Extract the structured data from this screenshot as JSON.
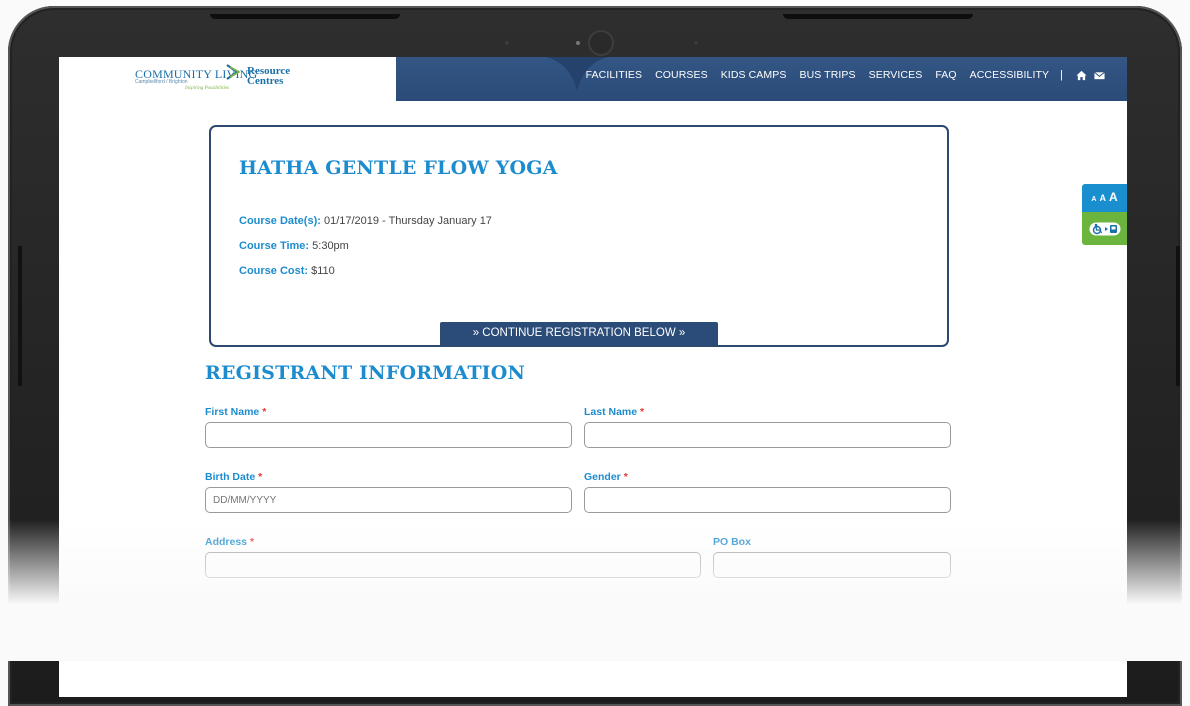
{
  "brand": {
    "name_main": "COMMUNITY LIVING",
    "name_sub": "Campbellford / Brighton",
    "tagline": "Inspiring Possibilities",
    "resource_line1": "Resource",
    "resource_line2": "Centres"
  },
  "nav": {
    "items": [
      "FACILITIES",
      "COURSES",
      "KIDS CAMPS",
      "BUS TRIPS",
      "SERVICES",
      "FAQ",
      "ACCESSIBILITY"
    ],
    "separator": "|",
    "icons": [
      "home-icon",
      "envelope-icon"
    ]
  },
  "accessibility_widget": {
    "size_labels": [
      "A",
      "A",
      "A"
    ],
    "tool_icon": "wheelchair-icon"
  },
  "course": {
    "title": "HATHA GENTLE FLOW YOGA",
    "date_label": "Course Date(s):",
    "date_value": " 01/17/2019 - Thursday January 17",
    "time_label": "Course Time:",
    "time_value": " 5:30pm",
    "cost_label": "Course Cost:",
    "cost_value": " $110",
    "continue_label": "» CONTINUE REGISTRATION BELOW »"
  },
  "registrant": {
    "title": "REGISTRANT INFORMATION",
    "required_marker": "*",
    "first_name_label": "First Name",
    "last_name_label": "Last Name",
    "birth_date_label": "Birth Date",
    "birth_date_placeholder": "DD/MM/YYYY",
    "gender_label": "Gender",
    "address_label": "Address",
    "po_box_label": "PO Box"
  },
  "colors": {
    "nav_bg": "#2b4b78",
    "accent_blue": "#1d8ccf",
    "required_red": "#e53935",
    "access_green": "#6bb43e"
  }
}
